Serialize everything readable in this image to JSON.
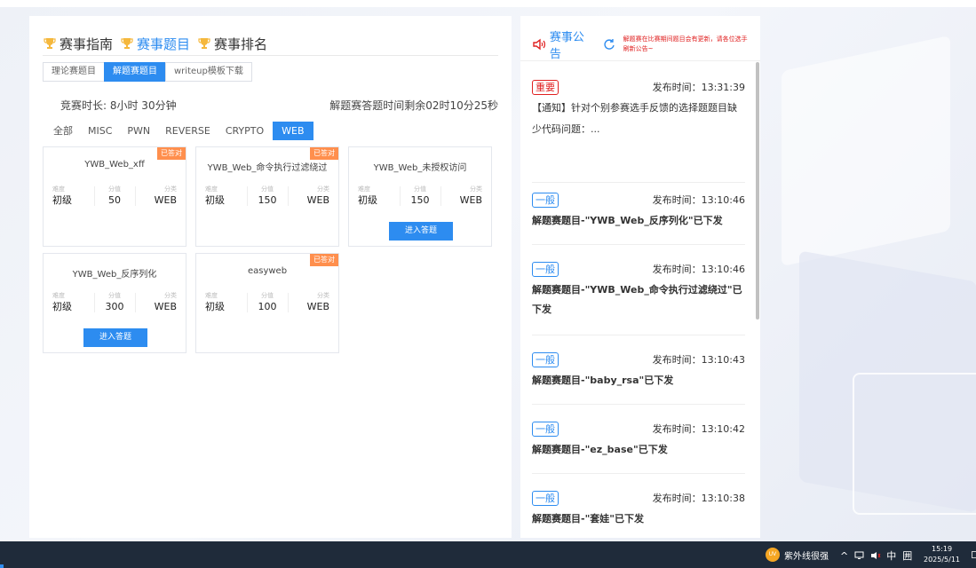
{
  "nav": {
    "items": [
      {
        "label": "赛事指南",
        "active": false
      },
      {
        "label": "赛事题目",
        "active": true
      },
      {
        "label": "赛事排名",
        "active": false
      }
    ]
  },
  "subtabs": [
    {
      "label": "理论赛题目",
      "active": false
    },
    {
      "label": "解题赛题目",
      "active": true
    },
    {
      "label": "writeup模板下载",
      "active": false
    }
  ],
  "time": {
    "duration": "竞赛时长: 8小时 30分钟",
    "remaining": "解题赛答题时间剩余02时10分25秒"
  },
  "categories": [
    {
      "label": "全部",
      "active": false
    },
    {
      "label": "MISC",
      "active": false
    },
    {
      "label": "PWN",
      "active": false
    },
    {
      "label": "REVERSE",
      "active": false
    },
    {
      "label": "CRYPTO",
      "active": false
    },
    {
      "label": "WEB",
      "active": true
    }
  ],
  "stat_labels": {
    "difficulty": "难度",
    "score": "分值",
    "category": "分类"
  },
  "cards": [
    {
      "title": "YWB_Web_xff",
      "ribbon": "已答对",
      "difficulty": "初级",
      "score": "50",
      "category": "WEB",
      "button": ""
    },
    {
      "title": "YWB_Web_命令执行过滤绕过",
      "ribbon": "已答对",
      "difficulty": "初级",
      "score": "150",
      "category": "WEB",
      "button": ""
    },
    {
      "title": "YWB_Web_未授权访问",
      "ribbon": "",
      "difficulty": "初级",
      "score": "150",
      "category": "WEB",
      "button": "进入答题"
    },
    {
      "title": "YWB_Web_反序列化",
      "ribbon": "",
      "difficulty": "初级",
      "score": "300",
      "category": "WEB",
      "button": "进入答题"
    },
    {
      "title": "easyweb",
      "ribbon": "已答对",
      "difficulty": "初级",
      "score": "100",
      "category": "WEB",
      "button": ""
    }
  ],
  "announcements": {
    "title": "赛事公告",
    "note": "解题赛在比赛期间题目会有更新，请各位选手刷新公告~",
    "items": [
      {
        "badge": "重要",
        "time": "发布时间：13:31:39",
        "body": "【通知】针对个别参赛选手反馈的选择题题目缺少代码问题：..."
      },
      {
        "badge": "一般",
        "time": "发布时间：13:10:46",
        "body": "解题赛题目-\"YWB_Web_反序列化\"已下发"
      },
      {
        "badge": "一般",
        "time": "发布时间：13:10:46",
        "body": "解题赛题目-\"YWB_Web_命令执行过滤绕过\"已下发"
      },
      {
        "badge": "一般",
        "time": "发布时间：13:10:43",
        "body": "解题赛题目-\"baby_rsa\"已下发"
      },
      {
        "badge": "一般",
        "time": "发布时间：13:10:42",
        "body": "解题赛题目-\"ez_base\"已下发"
      },
      {
        "badge": "一般",
        "time": "发布时间：13:10:38",
        "body": "解题赛题目-\"套娃\"已下发"
      }
    ]
  },
  "taskbar": {
    "app_icon_text": "UV",
    "app_label": "紫外线很强",
    "tray": [
      "^",
      "中",
      "囲"
    ],
    "time": "15:19",
    "date": "2025/5/11"
  },
  "colors": {
    "accent": "#2d8cf0",
    "ribbon": "#ff8f4d",
    "important": "#e02020"
  }
}
